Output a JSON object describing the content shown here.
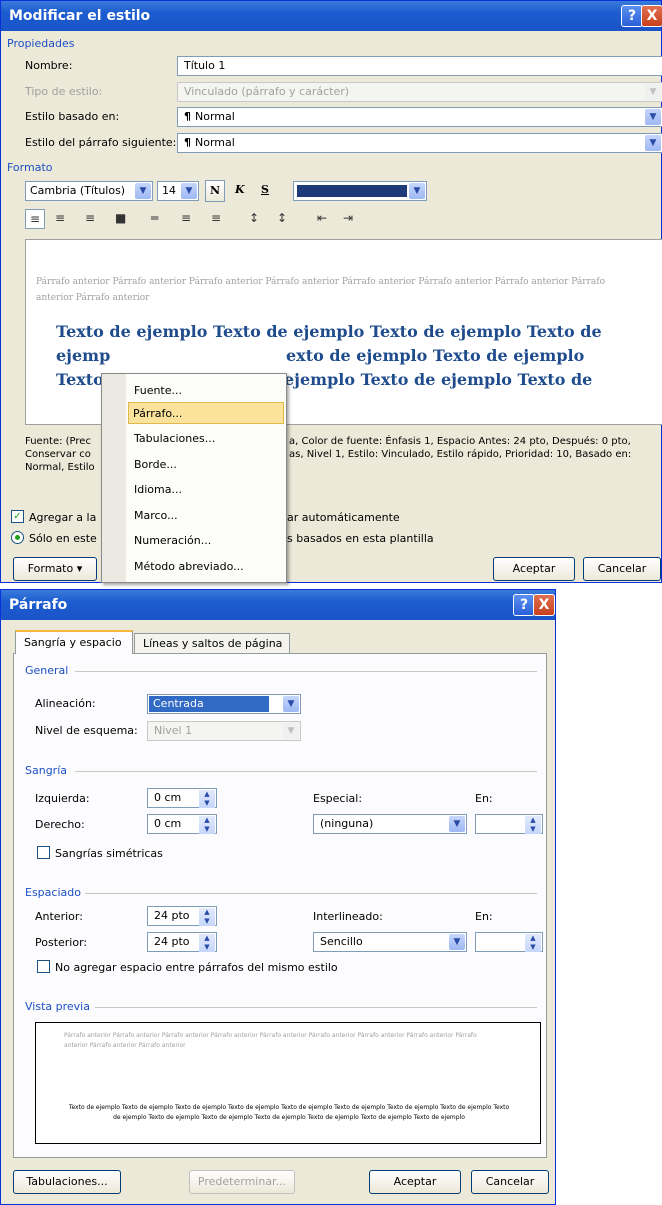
{
  "dlg1": {
    "title": "Modificar el estilo",
    "help": "?",
    "close": "X",
    "sections": {
      "props": "Propiedades",
      "format": "Formato"
    },
    "labels": {
      "name": "Nombre:",
      "type": "Tipo de estilo:",
      "based": "Estilo basado en:",
      "next": "Estilo del párrafo siguiente:"
    },
    "values": {
      "name": "Título 1",
      "type": "Vinculado (párrafo y carácter)",
      "based": "Normal",
      "next": "Normal"
    },
    "pilcrow": "¶",
    "font": "Cambria (Títulos)",
    "size": "14",
    "bold": "N",
    "italic": "K",
    "underline": "S",
    "font_color": "#1f3a78",
    "preview_prev": "Párrafo anterior Párrafo anterior Párrafo anterior Párrafo anterior Párrafo anterior Párrafo anterior Párrafo anterior Párrafo anterior Párrafo anterior",
    "preview_l1": "Texto de ejemplo Texto de ejemplo Texto de ejemplo Texto de",
    "preview_l2": "exto de ejemplo Texto de ejemplo",
    "preview_l2a": "ejemp",
    "preview_l3": "ejemplo Texto de ejemplo Texto de",
    "preview_l3a": "Texto",
    "desc1a": "Fuente: (Prec",
    "desc1b": "a, Color de fuente: Énfasis 1, Espacio Antes:  24 pto, Después:  0 pto,",
    "desc2a": "Conservar co",
    "desc2b": "as, Nivel 1, Estilo: Vinculado, Estilo rápido, Prioridad: 10, Basado en:",
    "desc3a": "Normal, Estilo",
    "add_a": "Agregar a la",
    "add_b": "ar automáticamente",
    "only_a": "Sólo en este",
    "only_b": "s basados en esta plantilla",
    "format_btn": "Formato ▾",
    "ok": "Aceptar",
    "cancel": "Cancelar",
    "menu": [
      "Fuente...",
      "Párrafo...",
      "Tabulaciones...",
      "Borde...",
      "Idioma...",
      "Marco...",
      "Numeración...",
      "Método abreviado..."
    ]
  },
  "dlg2": {
    "title": "Párrafo",
    "help": "?",
    "close": "X",
    "tabs": [
      "Sangría y espacio",
      "Líneas y saltos de página"
    ],
    "general": "General",
    "align_lbl": "Alineación:",
    "align_val": "Centrada",
    "outline_lbl": "Nivel de esquema:",
    "outline_val": "Nivel 1",
    "indent": "Sangría",
    "left_lbl": "Izquierda:",
    "left_val": "0 cm",
    "right_lbl": "Derecho:",
    "right_val": "0 cm",
    "special_lbl": "Especial:",
    "special_val": "(ninguna)",
    "by_lbl": "En:",
    "mirror": "Sangrías simétricas",
    "spacing": "Espaciado",
    "before_lbl": "Anterior:",
    "before_val": "24 pto",
    "after_lbl": "Posterior:",
    "after_val": "24 pto",
    "line_lbl": "Interlineado:",
    "line_val": "Sencillo",
    "at_lbl": "En:",
    "no_space": "No agregar espacio entre párrafos del mismo estilo",
    "preview": "Vista previa",
    "pv_prev": "Párrafo anterior Párrafo anterior Párrafo anterior Párrafo anterior Párrafo anterior Párrafo anterior Párrafo anterior Párrafo anterior Párrafo anterior Párrafo anterior Párrafo anterior",
    "pv_sample": "Texto de ejemplo Texto de ejemplo Texto de ejemplo Texto de ejemplo Texto de ejemplo Texto de ejemplo Texto de ejemplo Texto de ejemplo Texto de ejemplo Texto de ejemplo Texto de ejemplo Texto de ejemplo Texto de ejemplo Texto de ejemplo Texto de ejemplo",
    "tabs_btn": "Tabulaciones...",
    "default_btn": "Predeterminar...",
    "ok": "Aceptar",
    "cancel": "Cancelar"
  }
}
